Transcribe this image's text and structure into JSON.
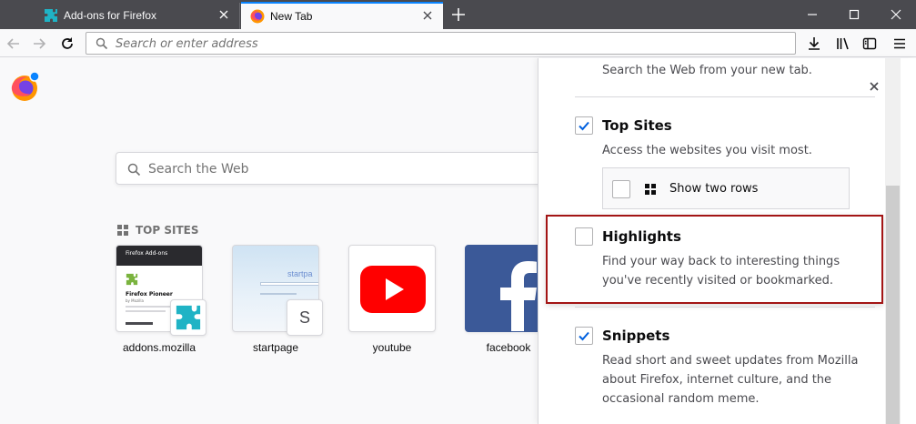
{
  "tabs": [
    {
      "title": "Add-ons for Firefox",
      "active": false,
      "icon": "puzzle-icon"
    },
    {
      "title": "New Tab",
      "active": true,
      "icon": "firefox-icon"
    }
  ],
  "colors": {
    "tabstrip": "#4a4a4f",
    "accent": "#0a84ff",
    "check": "#0060df",
    "puzzle": "#1fb3c5",
    "youtube_red": "#ff0000",
    "facebook_blue": "#3b5998",
    "highlight_border": "#a31515"
  },
  "urlbar": {
    "placeholder": "Search or enter address"
  },
  "newtab": {
    "search_placeholder": "Search the Web",
    "top_sites_header": "TOP SITES",
    "top_sites": [
      {
        "label": "addons.mozilla",
        "badge": "puzzle-icon",
        "thumb": "addons"
      },
      {
        "label": "startpage",
        "badge": "S",
        "thumb": "startpage"
      },
      {
        "label": "youtube",
        "badge": "",
        "thumb": "youtube"
      },
      {
        "label": "facebook",
        "badge": "",
        "thumb": "facebook"
      }
    ],
    "addons_thumb": {
      "brand": "Firefox Add-ons",
      "heading": "Firefox Pioneer",
      "by": "by Mozilla"
    },
    "startpage_thumb": {
      "brand": "startpa"
    }
  },
  "prefs": {
    "search_desc": "Search the Web from your new tab.",
    "top_sites": {
      "title": "Top Sites",
      "desc": "Access the websites you visit most.",
      "checked": true
    },
    "show_two_rows": {
      "label": "Show two rows",
      "checked": false
    },
    "highlights": {
      "title": "Highlights",
      "desc_line1": "Find your way back to interesting things",
      "desc_line2": "you've recently visited or bookmarked.",
      "checked": false
    },
    "snippets": {
      "title": "Snippets",
      "desc_line1": "Read short and sweet updates from Mozilla",
      "desc_line2": "about Firefox, internet culture, and the",
      "desc_line3": "occasional random meme.",
      "checked": true
    }
  }
}
